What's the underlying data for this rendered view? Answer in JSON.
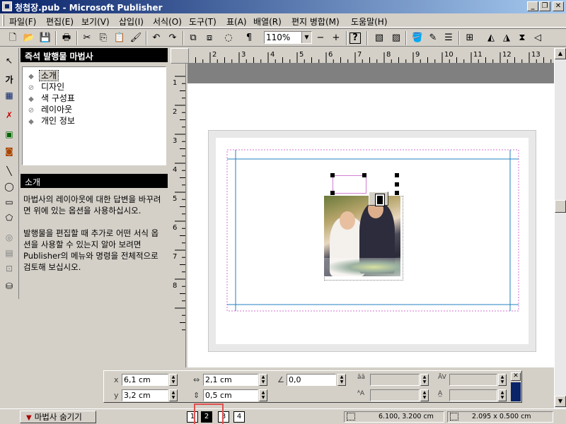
{
  "window": {
    "title": "청첩장.pub - Microsoft Publisher",
    "controls": {
      "minimize": "_",
      "restore": "❐",
      "close": "✕"
    }
  },
  "menu": [
    "파일(F)",
    "편집(E)",
    "보기(V)",
    "삽입(I)",
    "서식(O)",
    "도구(T)",
    "표(A)",
    "배열(R)",
    "편지 병합(M)",
    "도움말(H)"
  ],
  "toolbar": {
    "zoom_value": "110%",
    "paragraph_mark": "¶",
    "zoom_out": "−",
    "zoom_in": "+",
    "help": "?"
  },
  "objects_toolbar": {
    "text_tool_label": "가"
  },
  "wizard": {
    "title": "즉석 발행물 마법사",
    "items": [
      {
        "label": "소개",
        "marker": "◆",
        "selected": true
      },
      {
        "label": "디자인",
        "marker": "⊘",
        "selected": false
      },
      {
        "label": "색 구성표",
        "marker": "◆",
        "selected": false
      },
      {
        "label": "레이아웃",
        "marker": "⊘",
        "selected": false
      },
      {
        "label": "개인 정보",
        "marker": "◆",
        "selected": false
      }
    ],
    "section_title": "소개",
    "description": [
      "마법사의 레이아웃에 대한 답변을 바꾸려면 위에 있는 옵션을 사용하십시오.",
      "발행물을 편집할 때 추가로 어떤 서식 옵션을 사용할 수 있는지 알아 보려면 Publisher의 메뉴와 명령을 전체적으로 검토해 보십시오."
    ]
  },
  "rulers": {
    "horizontal_ticks": [
      "2",
      "3",
      "4",
      "5",
      "6",
      "7",
      "8",
      "9",
      "10",
      "11",
      "12",
      "13"
    ],
    "vertical_ticks": [
      "1",
      "2",
      "3",
      "4",
      "5",
      "6",
      "7",
      "8"
    ]
  },
  "measurements": {
    "x_label": "x",
    "x_value": "6,1 cm",
    "y_label": "y",
    "y_value": "3,2 cm",
    "width_value": "2,1 cm",
    "height_value": "0,5 cm",
    "rotation_value": "0,0"
  },
  "statusbar": {
    "wizard_toggle": "마법사 숨기기",
    "pages": [
      "1",
      "2",
      "3",
      "4"
    ],
    "active_page": "2",
    "position": "6.100, 3.200 cm",
    "size": "2.095 x   0.500 cm"
  },
  "colors": {
    "titlebar_start": "#0a246a",
    "titlebar_end": "#a6caf0",
    "chrome": "#d4d0c8",
    "margin_guide": "#d070d0",
    "layout_guide": "#2080c0"
  }
}
